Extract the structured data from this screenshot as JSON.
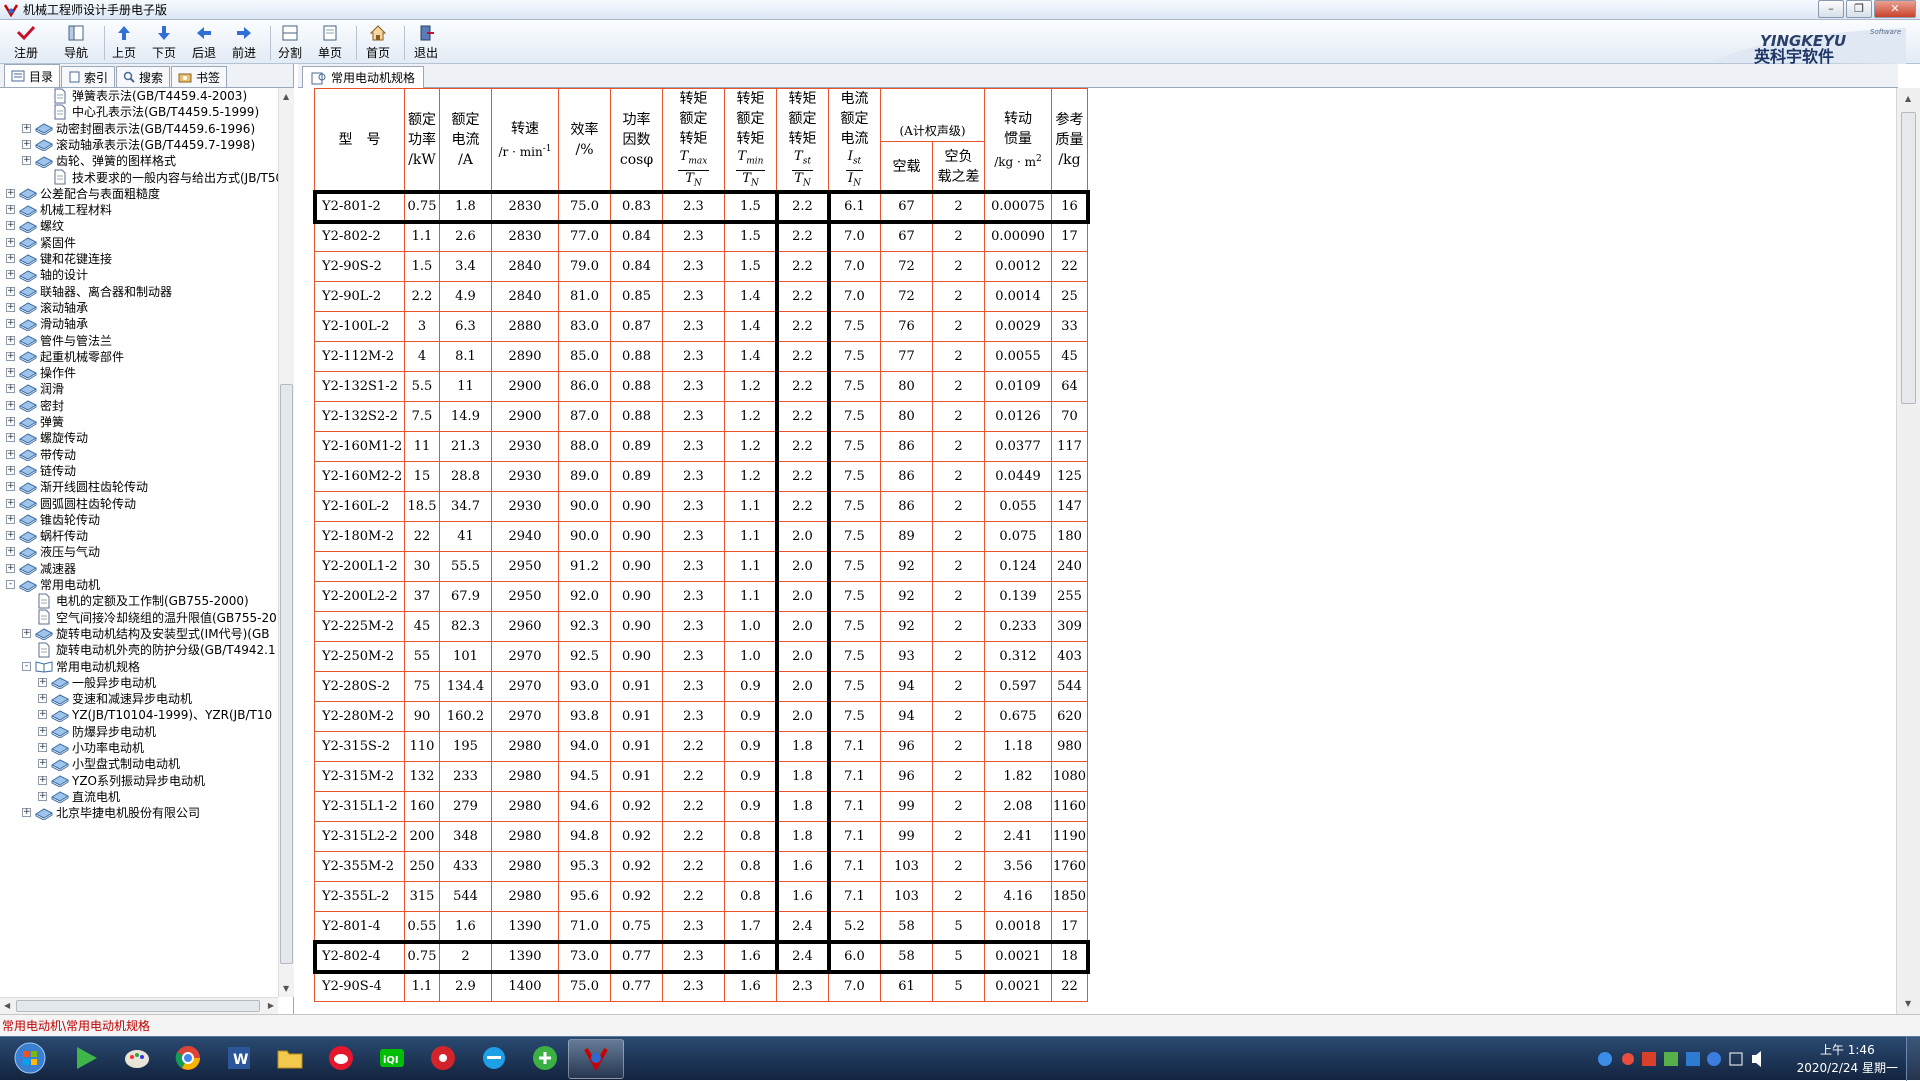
{
  "window": {
    "title": "机械工程师设计手册电子版"
  },
  "toolbar": {
    "register": "注册",
    "nav": "导航",
    "prev_page": "上页",
    "next_page": "下页",
    "back": "后退",
    "forward": "前进",
    "split": "分割",
    "single": "单页",
    "home": "首页",
    "exit": "退出"
  },
  "logo": {
    "name": "英科宇软件",
    "brand": "YINGKEYU",
    "tag": "Software"
  },
  "left_tabs": {
    "contents": "目录",
    "index": "索引",
    "search": "搜索",
    "bookmarks": "书签"
  },
  "tree": [
    {
      "label": "弹簧表示法(GB/T4459.4-2003)",
      "level": 2,
      "expand": "",
      "icon": "page"
    },
    {
      "label": "中心孔表示法(GB/T4459.5-1999)",
      "level": 2,
      "expand": "",
      "icon": "page"
    },
    {
      "label": "动密封圈表示法(GB/T4459.6-1996)",
      "level": 1,
      "expand": "+",
      "icon": "book"
    },
    {
      "label": "滚动轴承表示法(GB/T4459.7-1998)",
      "level": 1,
      "expand": "+",
      "icon": "book"
    },
    {
      "label": "齿轮、弹簧的图样格式",
      "level": 1,
      "expand": "+",
      "icon": "book"
    },
    {
      "label": "技术要求的一般内容与给出方式(JB/T50",
      "level": 2,
      "expand": "",
      "icon": "page"
    },
    {
      "label": "公差配合与表面粗糙度",
      "level": 0,
      "expand": "+",
      "icon": "book"
    },
    {
      "label": "机械工程材料",
      "level": 0,
      "expand": "+",
      "icon": "book"
    },
    {
      "label": "螺纹",
      "level": 0,
      "expand": "+",
      "icon": "book"
    },
    {
      "label": "紧固件",
      "level": 0,
      "expand": "+",
      "icon": "book"
    },
    {
      "label": "键和花键连接",
      "level": 0,
      "expand": "+",
      "icon": "book"
    },
    {
      "label": "轴的设计",
      "level": 0,
      "expand": "+",
      "icon": "book"
    },
    {
      "label": "联轴器、离合器和制动器",
      "level": 0,
      "expand": "+",
      "icon": "book"
    },
    {
      "label": "滚动轴承",
      "level": 0,
      "expand": "+",
      "icon": "book"
    },
    {
      "label": "滑动轴承",
      "level": 0,
      "expand": "+",
      "icon": "book"
    },
    {
      "label": "管件与管法兰",
      "level": 0,
      "expand": "+",
      "icon": "book"
    },
    {
      "label": "起重机械零部件",
      "level": 0,
      "expand": "+",
      "icon": "book"
    },
    {
      "label": "操作件",
      "level": 0,
      "expand": "+",
      "icon": "book"
    },
    {
      "label": "润滑",
      "level": 0,
      "expand": "+",
      "icon": "book"
    },
    {
      "label": "密封",
      "level": 0,
      "expand": "+",
      "icon": "book"
    },
    {
      "label": "弹簧",
      "level": 0,
      "expand": "+",
      "icon": "book"
    },
    {
      "label": "螺旋传动",
      "level": 0,
      "expand": "+",
      "icon": "book"
    },
    {
      "label": "带传动",
      "level": 0,
      "expand": "+",
      "icon": "book"
    },
    {
      "label": "链传动",
      "level": 0,
      "expand": "+",
      "icon": "book"
    },
    {
      "label": "渐开线圆柱齿轮传动",
      "level": 0,
      "expand": "+",
      "icon": "book"
    },
    {
      "label": "圆弧圆柱齿轮传动",
      "level": 0,
      "expand": "+",
      "icon": "book"
    },
    {
      "label": "锥齿轮传动",
      "level": 0,
      "expand": "+",
      "icon": "book"
    },
    {
      "label": "蜗杆传动",
      "level": 0,
      "expand": "+",
      "icon": "book"
    },
    {
      "label": "液压与气动",
      "level": 0,
      "expand": "+",
      "icon": "book"
    },
    {
      "label": "减速器",
      "level": 0,
      "expand": "+",
      "icon": "book"
    },
    {
      "label": "常用电动机",
      "level": 0,
      "expand": "-",
      "icon": "book"
    },
    {
      "label": "电机的定额及工作制(GB755-2000)",
      "level": 1,
      "expand": "",
      "icon": "page"
    },
    {
      "label": "空气间接冷却绕组的温升限值(GB755-20",
      "level": 1,
      "expand": "",
      "icon": "page"
    },
    {
      "label": "旋转电动机结构及安装型式(IM代号)(GB",
      "level": 1,
      "expand": "+",
      "icon": "book"
    },
    {
      "label": "旋转电动机外壳的防护分级(GB/T4942.1",
      "level": 1,
      "expand": "",
      "icon": "page"
    },
    {
      "label": "常用电动机规格",
      "level": 1,
      "expand": "-",
      "icon": "openbook"
    },
    {
      "label": "一般异步电动机",
      "level": 2,
      "expand": "+",
      "icon": "book"
    },
    {
      "label": "变速和减速异步电动机",
      "level": 2,
      "expand": "+",
      "icon": "book"
    },
    {
      "label": "YZ(JB/T10104-1999)、YZR(JB/T10",
      "level": 2,
      "expand": "+",
      "icon": "book"
    },
    {
      "label": "防爆异步电动机",
      "level": 2,
      "expand": "+",
      "icon": "book"
    },
    {
      "label": "小功率电动机",
      "level": 2,
      "expand": "+",
      "icon": "book"
    },
    {
      "label": "小型盘式制动电动机",
      "level": 2,
      "expand": "+",
      "icon": "book"
    },
    {
      "label": "YZO系列振动异步电动机",
      "level": 2,
      "expand": "+",
      "icon": "book"
    },
    {
      "label": "直流电机",
      "level": 2,
      "expand": "+",
      "icon": "book"
    },
    {
      "label": "北京毕捷电机股份有限公司",
      "level": 1,
      "expand": "+",
      "icon": "book"
    }
  ],
  "doc_tab": "常用电动机规格",
  "table": {
    "h_model": "型　号",
    "h_power": [
      "额定",
      "功率",
      "/kW"
    ],
    "h_current": [
      "额定",
      "电流",
      "/A"
    ],
    "h_speed": "转速",
    "h_speed_unit": "/r · min",
    "h_speed_exp": "-1",
    "h_eff": [
      "效率",
      "/%"
    ],
    "h_pf": [
      "功率",
      "因数",
      "cosφ"
    ],
    "h_tmax": [
      "转矩",
      "额定",
      "转矩"
    ],
    "h_tmin": [
      "转矩",
      "额定",
      "转矩"
    ],
    "h_tst": [
      "转矩",
      "额定",
      "转矩"
    ],
    "h_ist": [
      "电流",
      "额定",
      "电流"
    ],
    "h_noise_top": "(A计权声级)",
    "h_noise_idle": "空载",
    "h_noise_diff": [
      "空负",
      "载之差"
    ],
    "h_noise_unit": "/dB(A)",
    "h_inertia": [
      "转动",
      "惯量",
      "/kg · m"
    ],
    "h_inertia_exp": "2",
    "h_mass": [
      "参考",
      "质量",
      "/kg"
    ],
    "f_tmax": {
      "n": "T",
      "nsub": "max",
      "d": "T",
      "dsub": "N"
    },
    "f_tmin": {
      "n": "T",
      "nsub": "min",
      "d": "T",
      "dsub": "N"
    },
    "f_tst": {
      "n": "T",
      "nsub": "st",
      "d": "T",
      "dsub": "N"
    },
    "f_ist": {
      "n": "I",
      "nsub": "st",
      "d": "I",
      "dsub": "N"
    },
    "rows": [
      [
        "Y2-801-2",
        "0.75",
        "1.8",
        "2830",
        "75.0",
        "0.83",
        "2.3",
        "1.5",
        "2.2",
        "6.1",
        "67",
        "2",
        "0.00075",
        "16"
      ],
      [
        "Y2-802-2",
        "1.1",
        "2.6",
        "2830",
        "77.0",
        "0.84",
        "2.3",
        "1.5",
        "2.2",
        "7.0",
        "67",
        "2",
        "0.00090",
        "17"
      ],
      [
        "Y2-90S-2",
        "1.5",
        "3.4",
        "2840",
        "79.0",
        "0.84",
        "2.3",
        "1.5",
        "2.2",
        "7.0",
        "72",
        "2",
        "0.0012",
        "22"
      ],
      [
        "Y2-90L-2",
        "2.2",
        "4.9",
        "2840",
        "81.0",
        "0.85",
        "2.3",
        "1.4",
        "2.2",
        "7.0",
        "72",
        "2",
        "0.0014",
        "25"
      ],
      [
        "Y2-100L-2",
        "3",
        "6.3",
        "2880",
        "83.0",
        "0.87",
        "2.3",
        "1.4",
        "2.2",
        "7.5",
        "76",
        "2",
        "0.0029",
        "33"
      ],
      [
        "Y2-112M-2",
        "4",
        "8.1",
        "2890",
        "85.0",
        "0.88",
        "2.3",
        "1.4",
        "2.2",
        "7.5",
        "77",
        "2",
        "0.0055",
        "45"
      ],
      [
        "Y2-132S1-2",
        "5.5",
        "11",
        "2900",
        "86.0",
        "0.88",
        "2.3",
        "1.2",
        "2.2",
        "7.5",
        "80",
        "2",
        "0.0109",
        "64"
      ],
      [
        "Y2-132S2-2",
        "7.5",
        "14.9",
        "2900",
        "87.0",
        "0.88",
        "2.3",
        "1.2",
        "2.2",
        "7.5",
        "80",
        "2",
        "0.0126",
        "70"
      ],
      [
        "Y2-160M1-2",
        "11",
        "21.3",
        "2930",
        "88.0",
        "0.89",
        "2.3",
        "1.2",
        "2.2",
        "7.5",
        "86",
        "2",
        "0.0377",
        "117"
      ],
      [
        "Y2-160M2-2",
        "15",
        "28.8",
        "2930",
        "89.0",
        "0.89",
        "2.3",
        "1.2",
        "2.2",
        "7.5",
        "86",
        "2",
        "0.0449",
        "125"
      ],
      [
        "Y2-160L-2",
        "18.5",
        "34.7",
        "2930",
        "90.0",
        "0.90",
        "2.3",
        "1.1",
        "2.2",
        "7.5",
        "86",
        "2",
        "0.055",
        "147"
      ],
      [
        "Y2-180M-2",
        "22",
        "41",
        "2940",
        "90.0",
        "0.90",
        "2.3",
        "1.1",
        "2.0",
        "7.5",
        "89",
        "2",
        "0.075",
        "180"
      ],
      [
        "Y2-200L1-2",
        "30",
        "55.5",
        "2950",
        "91.2",
        "0.90",
        "2.3",
        "1.1",
        "2.0",
        "7.5",
        "92",
        "2",
        "0.124",
        "240"
      ],
      [
        "Y2-200L2-2",
        "37",
        "67.9",
        "2950",
        "92.0",
        "0.90",
        "2.3",
        "1.1",
        "2.0",
        "7.5",
        "92",
        "2",
        "0.139",
        "255"
      ],
      [
        "Y2-225M-2",
        "45",
        "82.3",
        "2960",
        "92.3",
        "0.90",
        "2.3",
        "1.0",
        "2.0",
        "7.5",
        "92",
        "2",
        "0.233",
        "309"
      ],
      [
        "Y2-250M-2",
        "55",
        "101",
        "2970",
        "92.5",
        "0.90",
        "2.3",
        "1.0",
        "2.0",
        "7.5",
        "93",
        "2",
        "0.312",
        "403"
      ],
      [
        "Y2-280S-2",
        "75",
        "134.4",
        "2970",
        "93.0",
        "0.91",
        "2.3",
        "0.9",
        "2.0",
        "7.5",
        "94",
        "2",
        "0.597",
        "544"
      ],
      [
        "Y2-280M-2",
        "90",
        "160.2",
        "2970",
        "93.8",
        "0.91",
        "2.3",
        "0.9",
        "2.0",
        "7.5",
        "94",
        "2",
        "0.675",
        "620"
      ],
      [
        "Y2-315S-2",
        "110",
        "195",
        "2980",
        "94.0",
        "0.91",
        "2.2",
        "0.9",
        "1.8",
        "7.1",
        "96",
        "2",
        "1.18",
        "980"
      ],
      [
        "Y2-315M-2",
        "132",
        "233",
        "2980",
        "94.5",
        "0.91",
        "2.2",
        "0.9",
        "1.8",
        "7.1",
        "96",
        "2",
        "1.82",
        "1080"
      ],
      [
        "Y2-315L1-2",
        "160",
        "279",
        "2980",
        "94.6",
        "0.92",
        "2.2",
        "0.9",
        "1.8",
        "7.1",
        "99",
        "2",
        "2.08",
        "1160"
      ],
      [
        "Y2-315L2-2",
        "200",
        "348",
        "2980",
        "94.8",
        "0.92",
        "2.2",
        "0.8",
        "1.8",
        "7.1",
        "99",
        "2",
        "2.41",
        "1190"
      ],
      [
        "Y2-355M-2",
        "250",
        "433",
        "2980",
        "95.3",
        "0.92",
        "2.2",
        "0.8",
        "1.6",
        "7.1",
        "103",
        "2",
        "3.56",
        "1760"
      ],
      [
        "Y2-355L-2",
        "315",
        "544",
        "2980",
        "95.6",
        "0.92",
        "2.2",
        "0.8",
        "1.6",
        "7.1",
        "103",
        "2",
        "4.16",
        "1850"
      ],
      [
        "Y2-801-4",
        "0.55",
        "1.6",
        "1390",
        "71.0",
        "0.75",
        "2.3",
        "1.7",
        "2.4",
        "5.2",
        "58",
        "5",
        "0.0018",
        "17"
      ],
      [
        "Y2-802-4",
        "0.75",
        "2",
        "1390",
        "73.0",
        "0.77",
        "2.3",
        "1.6",
        "2.4",
        "6.0",
        "58",
        "5",
        "0.0021",
        "18"
      ],
      [
        "Y2-90S-4",
        "1.1",
        "2.9",
        "1400",
        "75.0",
        "0.77",
        "2.3",
        "1.6",
        "2.3",
        "7.0",
        "61",
        "5",
        "0.0021",
        "22"
      ]
    ]
  },
  "status": "常用电动机\\常用电动机规格",
  "clock": {
    "time": "上午 1:46",
    "date": "2020/2/24 星期一"
  },
  "taskbar_apps": [
    "start-orb-icon",
    "media-player-icon",
    "paint-icon",
    "chrome-icon",
    "word-icon",
    "file-explorer-icon",
    "weibo-icon",
    "iqiyi-icon",
    "pinwheel-app-icon",
    "ie-icon",
    "shield-browser-icon",
    "handbook-app-icon"
  ],
  "colors": {
    "grid": "#e8542e",
    "status_text": "#c00000",
    "taskbar": "#1b3150"
  }
}
